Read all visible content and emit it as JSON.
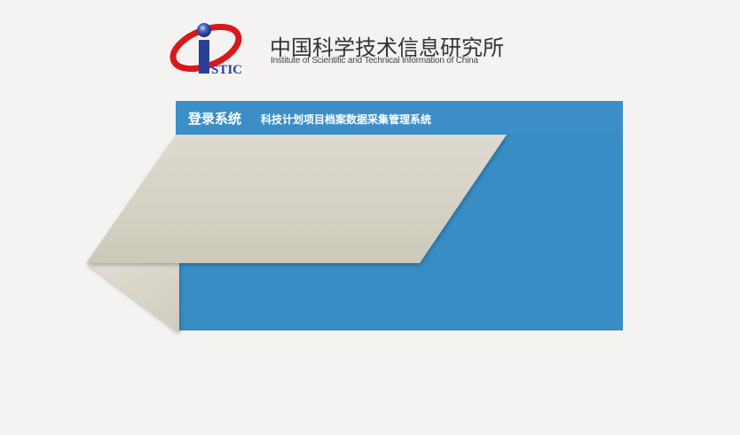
{
  "header": {
    "logo_text": "STIC",
    "org_name_cn": "中国科学技术信息研究所",
    "org_name_en": "Institute of Scientific and Technical Information of China"
  },
  "login_panel": {
    "title": "登录系统",
    "subtitle": "科技计划项目档案数据采集管理系统"
  },
  "colors": {
    "background": "#f4f3f1",
    "panel_blue": "#378dc4",
    "ribbon_beige": "#d6d2c5",
    "logo_red": "#d7191c",
    "logo_blue": "#2a3f9a"
  }
}
